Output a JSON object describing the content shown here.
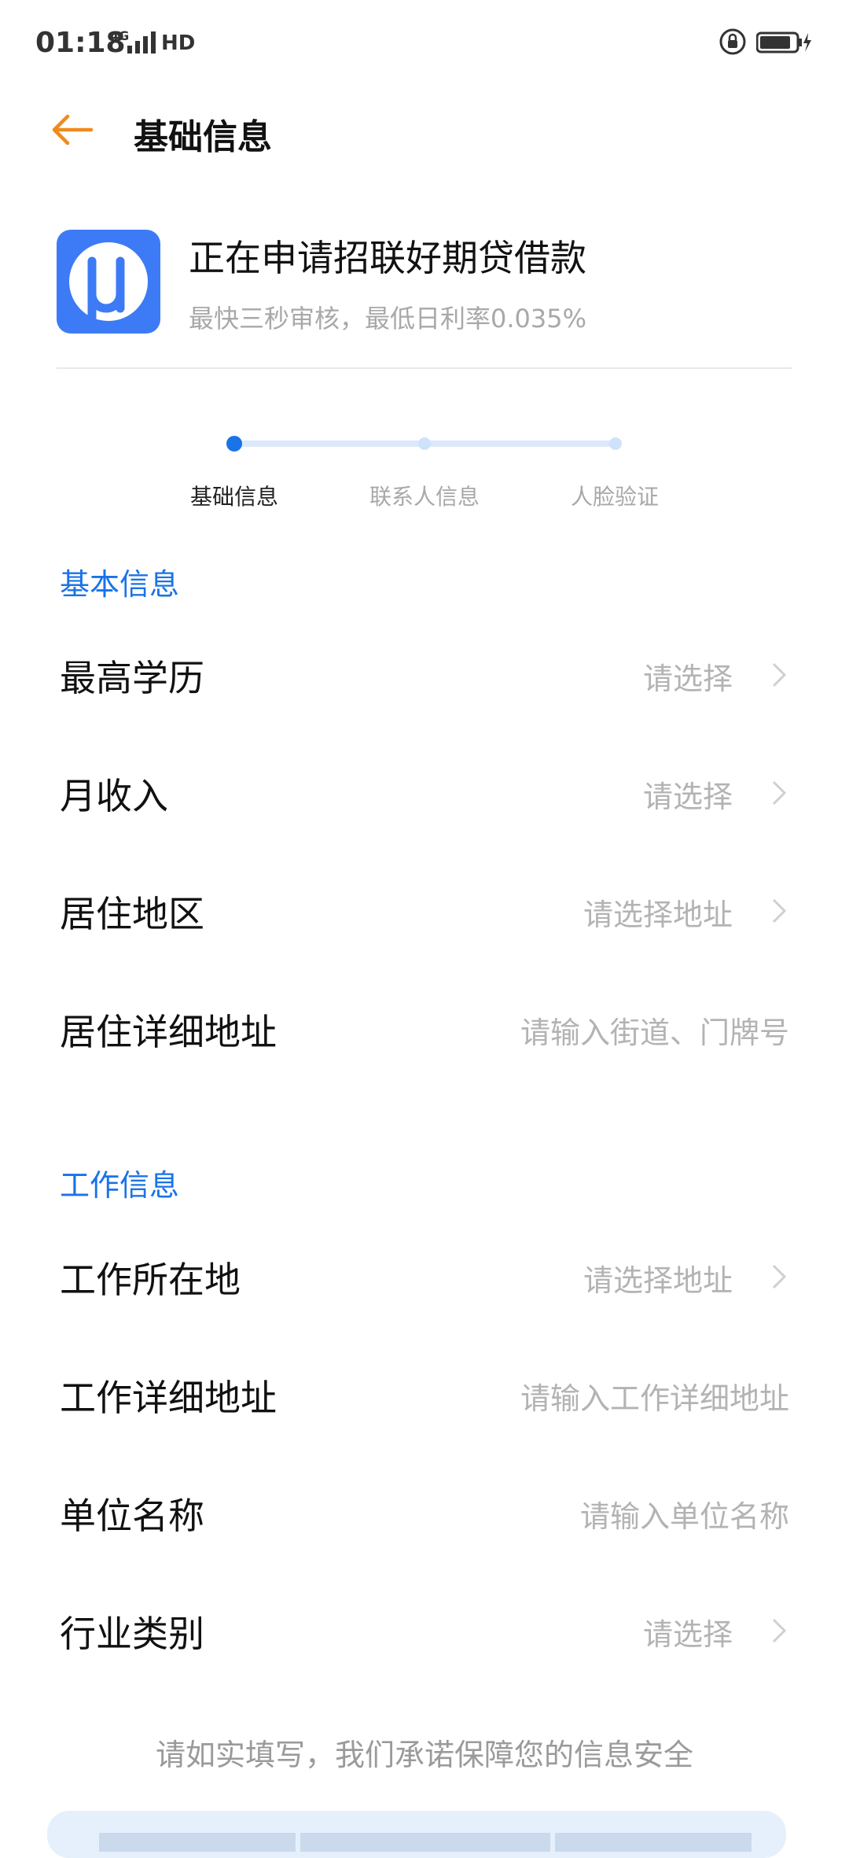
{
  "status_bar": {
    "time": "01:18",
    "network": "4G",
    "hd": "HD"
  },
  "nav": {
    "title": "基础信息"
  },
  "app": {
    "title": "正在申请招联好期贷借款",
    "subtitle": "最快三秒审核，最低日利率0.035%",
    "logo_char": "μ",
    "logo_color": "#3c7bf5"
  },
  "steps": [
    {
      "label": "基础信息",
      "active": true
    },
    {
      "label": "联系人信息",
      "active": false
    },
    {
      "label": "人脸验证",
      "active": false
    }
  ],
  "sections": {
    "basic": {
      "title": "基本信息",
      "rows": [
        {
          "label": "最高学历",
          "value": "请选择"
        },
        {
          "label": "月收入",
          "value": "请选择"
        },
        {
          "label": "居住地区",
          "value": "请选择地址"
        },
        {
          "label": "居住详细地址",
          "value": "请输入街道、门牌号"
        }
      ]
    },
    "work": {
      "title": "工作信息",
      "rows": [
        {
          "label": "工作所在地",
          "value": "请选择地址"
        },
        {
          "label": "工作详细地址",
          "value": "请输入工作详细地址"
        },
        {
          "label": "单位名称",
          "value": "请输入单位名称"
        },
        {
          "label": "行业类别",
          "value": "请选择"
        }
      ]
    }
  },
  "footer": {
    "note": "请如实填写，我们承诺保障您的信息安全"
  },
  "colors": {
    "accent": "#1a73e8",
    "back_arrow": "#f08a1c",
    "placeholder": "#b3b3b3"
  }
}
